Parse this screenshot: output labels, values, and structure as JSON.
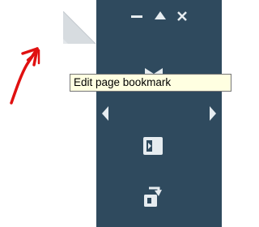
{
  "tooltip": {
    "text": "Edit page bookmark"
  },
  "window_controls": {
    "minimize_icon": "minimize-icon",
    "collapse_icon": "triangle-up-icon",
    "close_icon": "close-x-icon"
  },
  "navigation": {
    "prev_icon": "chevron-left-icon",
    "next_icon": "chevron-right-icon",
    "bookmark_icon": "bookmark-glyph-icon"
  },
  "tools": [
    {
      "icon": "open-book-icon"
    },
    {
      "icon": "rotate-page-icon"
    }
  ],
  "annotation": {
    "icon": "red-arrow-annotation",
    "color": "#e01010"
  },
  "colors": {
    "panel": "#2f4a5e",
    "icon": "#e6ecf0",
    "tooltip_bg": "#ffffe1"
  }
}
